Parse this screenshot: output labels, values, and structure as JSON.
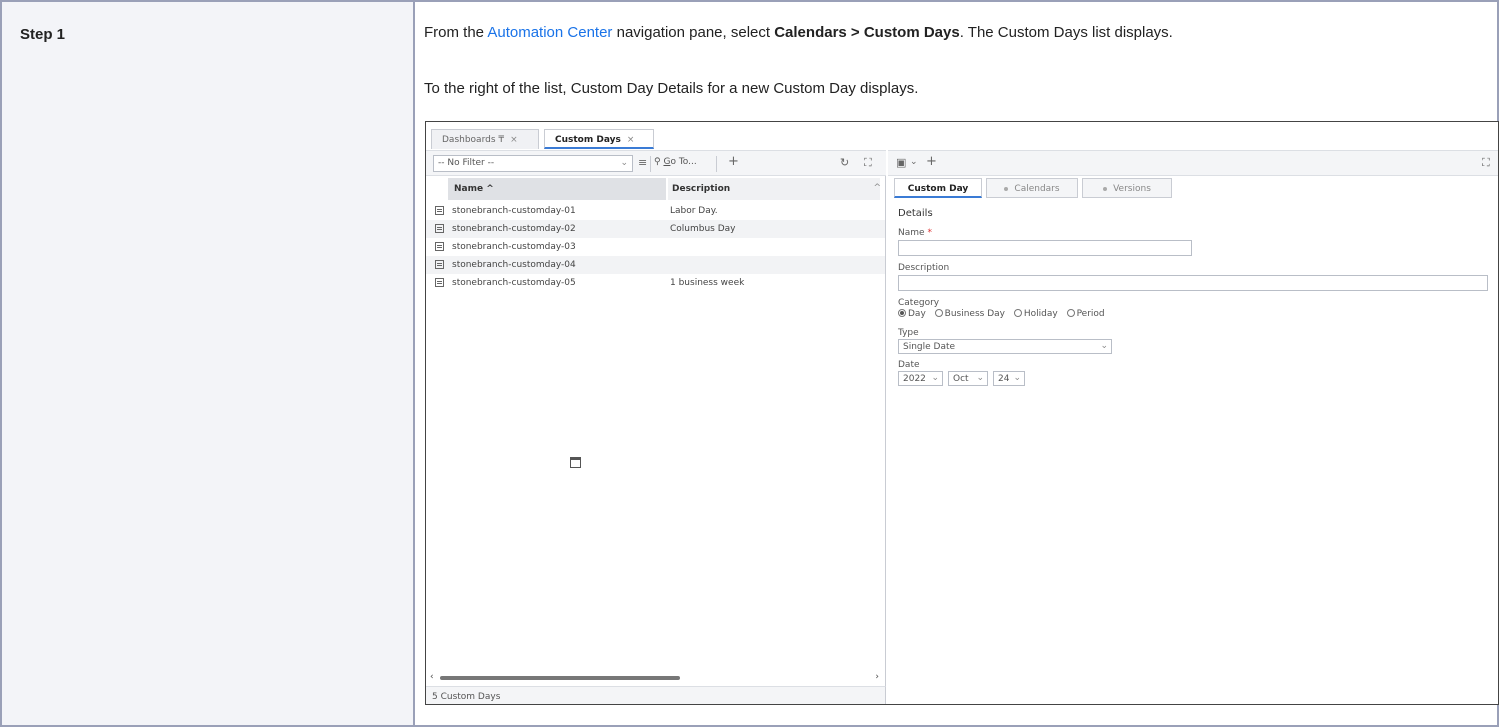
{
  "doc": {
    "step_label": "Step 1",
    "p1_prefix": "From the ",
    "p1_link": "Automation Center",
    "p1_mid": " navigation pane, select ",
    "p1_bold": "Calendars > Custom Days",
    "p1_suffix": ". The Custom Days list displays.",
    "p2": "To the right of the list, Custom Day Details for a new Custom Day displays."
  },
  "app": {
    "tabs": [
      {
        "label": "Dashboards",
        "pin": "₸",
        "close": "×"
      },
      {
        "label": "Custom Days",
        "close": "×"
      }
    ],
    "filter": {
      "value": "-- No Filter --"
    },
    "goto": {
      "prefix": "G",
      "rest": "o To..."
    },
    "list": {
      "col_name": "Name",
      "col_desc": "Description",
      "rows": [
        {
          "name": "stonebranch-customday-01",
          "desc": "Labor Day."
        },
        {
          "name": "stonebranch-customday-02",
          "desc": "Columbus Day"
        },
        {
          "name": "stonebranch-customday-03",
          "desc": ""
        },
        {
          "name": "stonebranch-customday-04",
          "desc": ""
        },
        {
          "name": "stonebranch-customday-05",
          "desc": "1 business week"
        }
      ],
      "count": "5 Custom Days"
    },
    "detail": {
      "tabs": [
        "Custom Day",
        "Calendars",
        "Versions"
      ],
      "section": "Details",
      "name_label": "Name",
      "required_mark": "*",
      "desc_label": "Description",
      "category_label": "Category",
      "category_options": [
        "Day",
        "Business Day",
        "Holiday",
        "Period"
      ],
      "category_selected": "Day",
      "type_label": "Type",
      "type_value": "Single Date",
      "date_label": "Date",
      "date_year": "2022",
      "date_month": "Oct",
      "date_day": "24"
    }
  }
}
